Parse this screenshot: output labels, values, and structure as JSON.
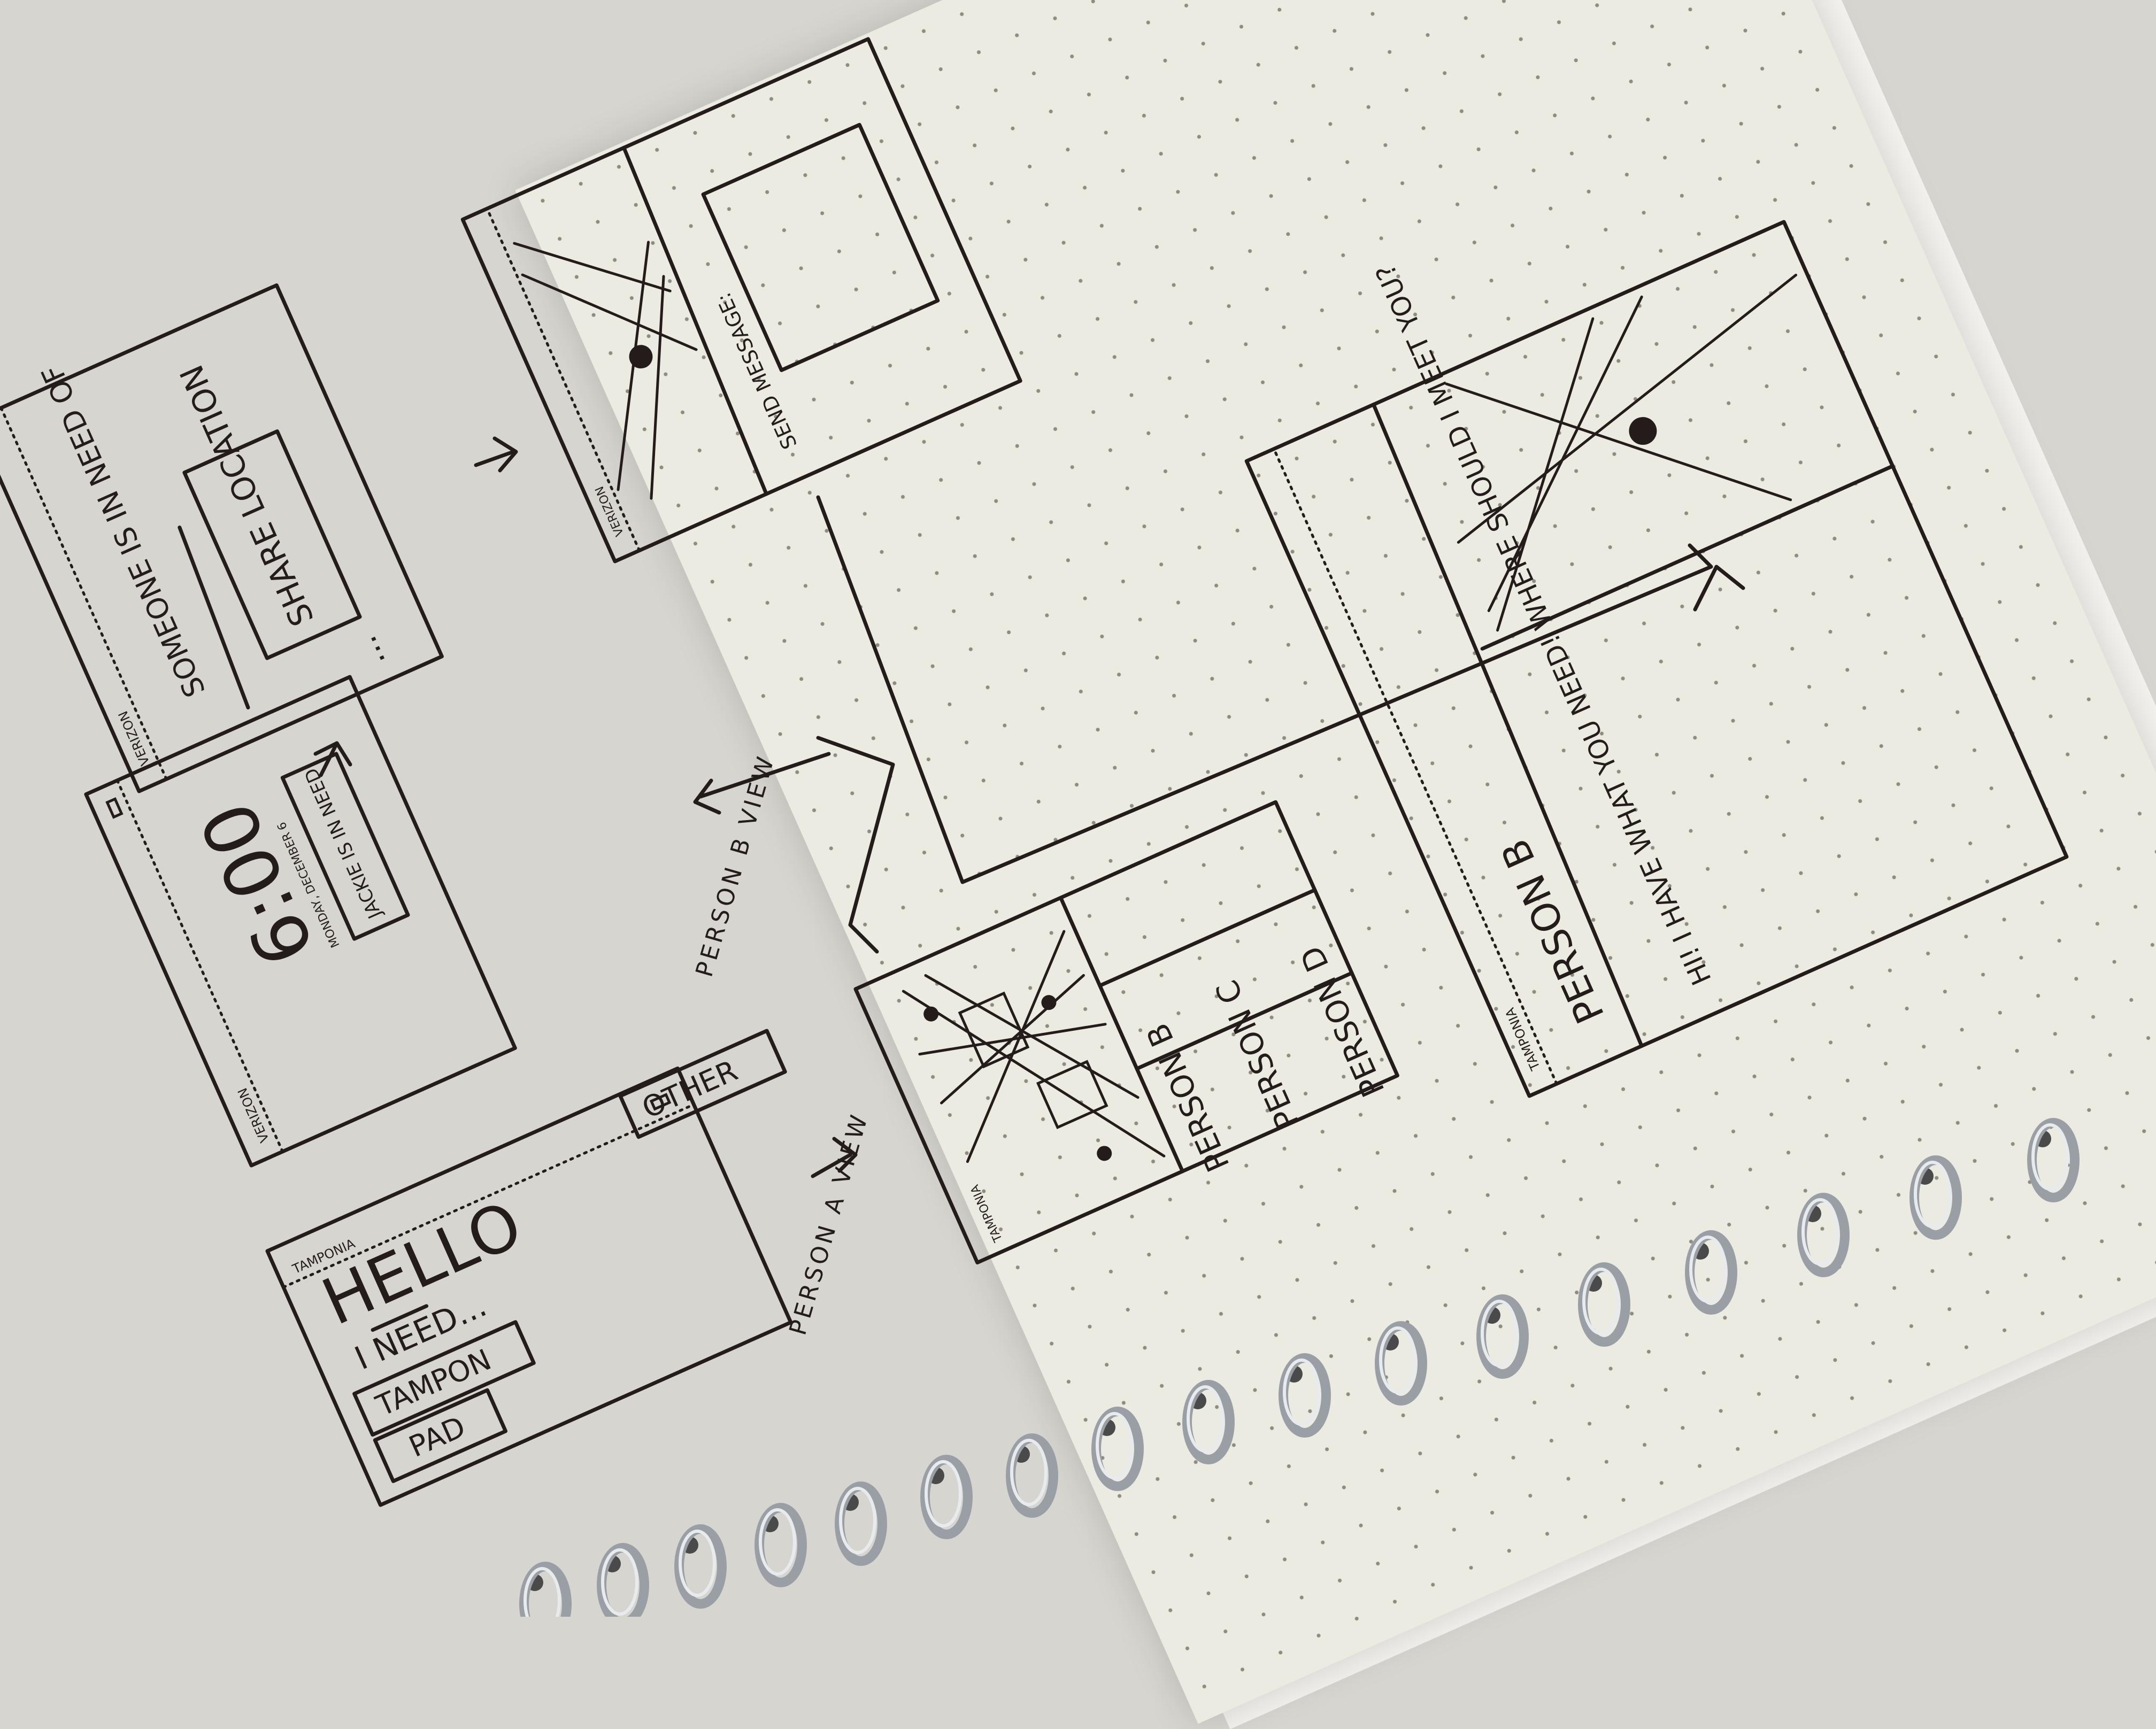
{
  "screens": {
    "hello": {
      "carrier": "TAMPONIA",
      "greeting": "HELLO",
      "prompt": "I NEED...",
      "options": [
        "TAMPON",
        "PAD",
        "OTHER"
      ]
    },
    "lock": {
      "carrier": "VERIZON",
      "time": "6:00",
      "date": "MONDAY, DECEMBER 6",
      "notification": "JACKIE IS IN NEED!",
      "dots": "..."
    },
    "alert": {
      "carrier": "VERIZON",
      "message": "SOMEONE IS IN NEED OF",
      "button": "SHARE LOCATION"
    },
    "map_message": {
      "carrier": "VERIZON",
      "send_label": "SEND MESSAGE:"
    },
    "person_list": {
      "carrier": "TAMPONIA",
      "people": [
        "PERSON B",
        "PERSON C",
        "PERSON D"
      ]
    },
    "chat": {
      "carrier": "TAMPONIA",
      "title": "PERSON B",
      "message": "HI! I HAVE WHAT YOU NEED! WHERE SHOULD I MEET YOU?"
    }
  },
  "labels": {
    "person_a": "PERSON A VIEW",
    "person_b": "PERSON B VIEW"
  }
}
